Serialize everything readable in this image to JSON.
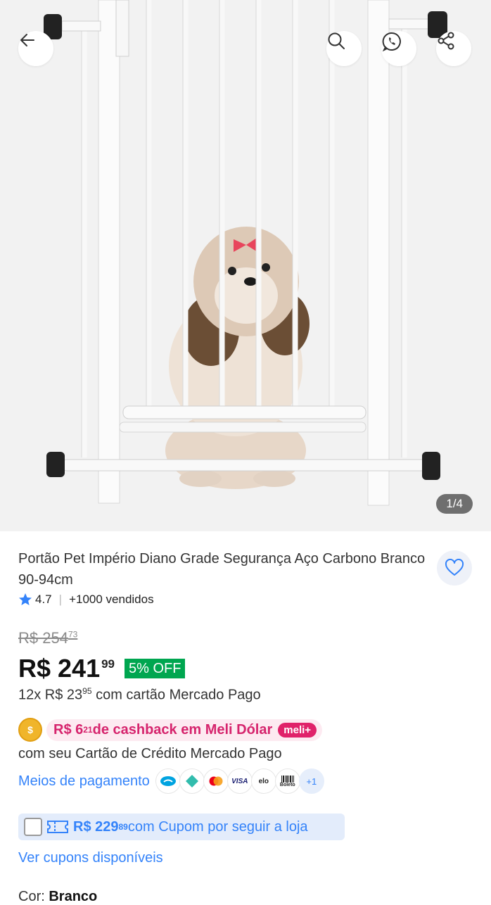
{
  "gallery": {
    "counter": "1/4"
  },
  "product": {
    "title": "Portão Pet Império Diano Grade Segurança Aço Carbono Branco 90-94cm",
    "rating": "4.7",
    "sold": "+1000 vendidos"
  },
  "pricing": {
    "old_price": "R$ 254",
    "old_cents": "73",
    "price": "R$ 241",
    "price_cents": "99",
    "discount": "5% OFF",
    "installments_prefix": "12x R$ 23",
    "installments_cents": "95",
    "installments_suffix": " com cartão Mercado Pago"
  },
  "cashback": {
    "amount": "R$ 6",
    "amount_cents": "21",
    "text": " de cashback em Meli Dólar",
    "badge": "meli+",
    "subtext": "com seu Cartão de Crédito Mercado Pago"
  },
  "payments": {
    "link": "Meios de pagamento",
    "methods": [
      "mercado-pago-icon",
      "pix-icon",
      "mastercard-icon",
      "VISA",
      "elo",
      "Boleto"
    ],
    "more": "+1"
  },
  "coupon": {
    "amount": "R$ 229",
    "amount_cents": "89",
    "text": " com Cupom por seguir a loja"
  },
  "links": {
    "see_coupons": "Ver cupons disponíveis"
  },
  "variation": {
    "label": "Cor: ",
    "value": "Branco"
  },
  "colors": {
    "accent": "#3483fa",
    "discount": "#00a650",
    "cashback": "#d6246d",
    "meli_badge": "#e0226a"
  }
}
